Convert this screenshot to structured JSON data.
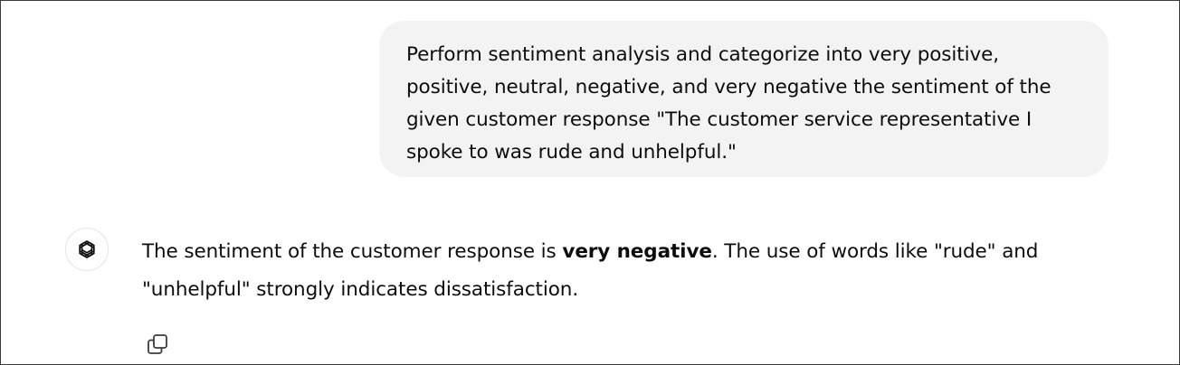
{
  "conversation": {
    "user_message": "Perform sentiment analysis and categorize into very positive, positive, neutral, negative, and very negative the sentiment of the given customer response \"The customer service representative I spoke to was rude and unhelpful.\"",
    "assistant_message": {
      "before_bold": "The sentiment of the customer response is ",
      "bold": "very negative",
      "after_bold": ". The use of words like \"rude\" and \"unhelpful\" strongly indicates dissatisfaction."
    }
  },
  "icons": {
    "assistant_avatar": "openai-logo-icon",
    "copy": "copy-icon"
  },
  "colors": {
    "user_bubble_bg": "#f3f3f3",
    "text": "#0d0d0d",
    "border": "#3a3a3a"
  }
}
